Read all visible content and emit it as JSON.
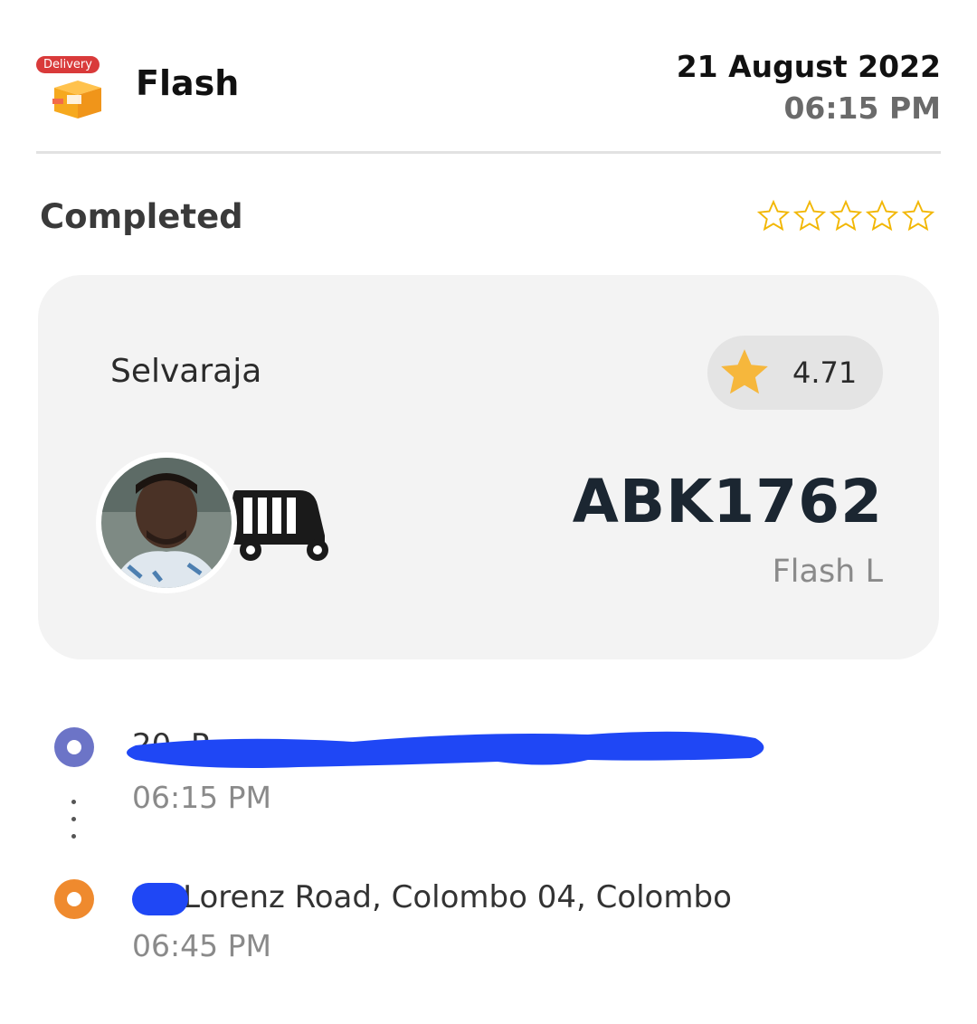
{
  "header": {
    "badge": "Delivery",
    "service_name": "Flash",
    "date": "21 August 2022",
    "time": "06:15 PM"
  },
  "trip": {
    "status": "Completed",
    "user_rating_stars": 0,
    "max_stars": 5
  },
  "driver": {
    "name": "Selvaraja",
    "rating": "4.71",
    "plate": "ABK1762",
    "vehicle_type": "Flash L"
  },
  "route": {
    "pickup_address": "20, P...",
    "pickup_time": "06:15 PM",
    "drop_address": "C , Lorenz Road, Colombo 04, Colombo",
    "drop_time": "06:45 PM"
  },
  "colors": {
    "pickup": "#6c74c7",
    "drop": "#ef8a2e",
    "star": "#f6b73c",
    "redaction": "#1f47f5"
  }
}
